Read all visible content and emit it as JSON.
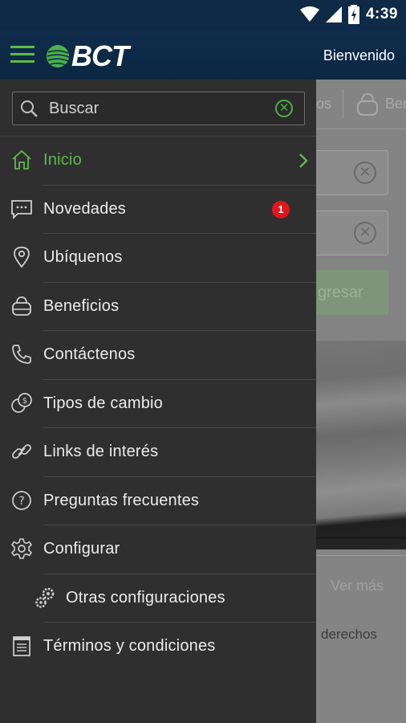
{
  "status_bar": {
    "time": "4:39",
    "icons": [
      "wifi-icon",
      "signal-icon",
      "battery-icon"
    ]
  },
  "header": {
    "logo_text": "BCT",
    "welcome": "Bienvenido"
  },
  "search": {
    "placeholder": "Buscar"
  },
  "menu": {
    "items": [
      {
        "label": "Inicio",
        "icon": "home-icon",
        "active": true
      },
      {
        "label": "Novedades",
        "icon": "chat-icon",
        "badge": "1"
      },
      {
        "label": "Ubíquenos",
        "icon": "location-pin-icon"
      },
      {
        "label": "Beneficios",
        "icon": "bag-icon"
      },
      {
        "label": "Contáctenos",
        "icon": "phone-icon"
      },
      {
        "label": "Tipos de cambio",
        "icon": "currency-exchange-icon"
      },
      {
        "label": "Links de interés",
        "icon": "link-icon"
      },
      {
        "label": "Preguntas frecuentes",
        "icon": "help-icon"
      },
      {
        "label": "Configurar",
        "icon": "gear-icon"
      },
      {
        "label": "Otras configuraciones",
        "icon": "gears-icon"
      },
      {
        "label": "Términos y condiciones",
        "icon": "document-icon"
      }
    ]
  },
  "background": {
    "tab1_fragment": "os",
    "tab2_fragment": "Ber",
    "button_fragment": "gresar",
    "see_more": "Ver más",
    "rights_fragment": "derechos"
  },
  "colors": {
    "accent": "#5dbb4b",
    "header": "#0e2a47",
    "drawer": "#2f2f2f",
    "badge": "#e4141b"
  }
}
